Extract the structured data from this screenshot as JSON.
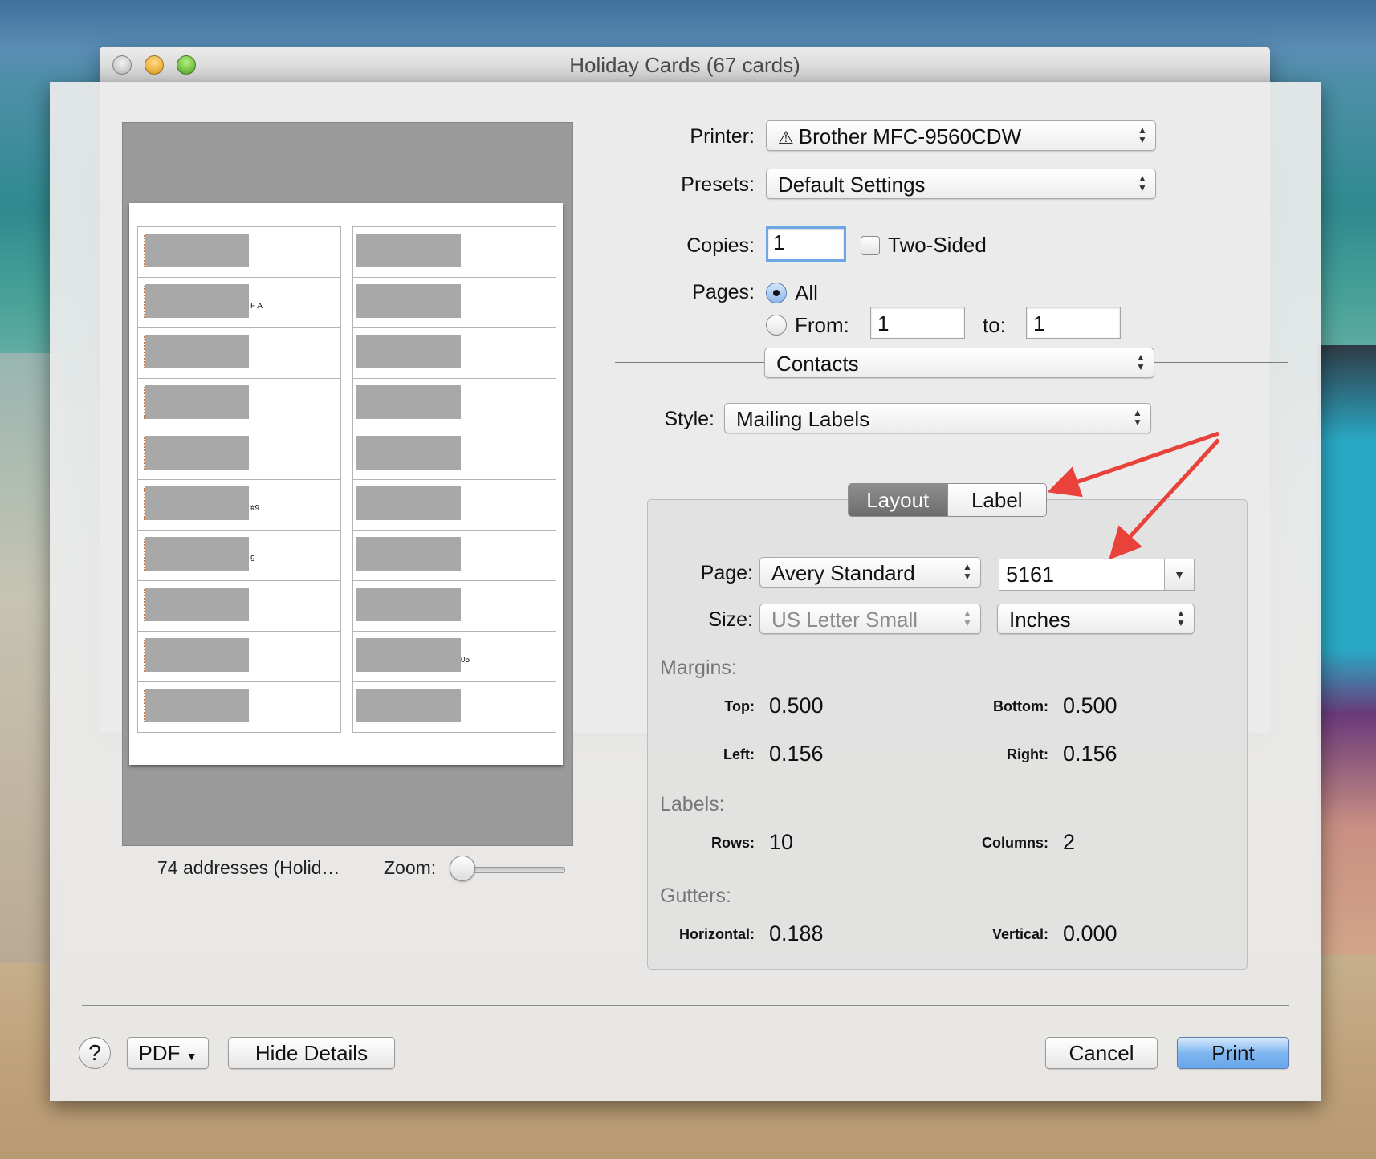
{
  "window": {
    "title": "Holiday Cards (67 cards)"
  },
  "preview": {
    "caption": "74 addresses (Holid…",
    "zoom_label": "Zoom:",
    "zoom_level": 0,
    "labels": [
      {
        "col": 1,
        "tag": ""
      },
      {
        "col": 2,
        "tag": ""
      },
      {
        "col": 1,
        "tag": "F A"
      },
      {
        "col": 2,
        "tag": ""
      },
      {
        "col": 1,
        "tag": ""
      },
      {
        "col": 2,
        "tag": ""
      },
      {
        "col": 1,
        "tag": ""
      },
      {
        "col": 2,
        "tag": ""
      },
      {
        "col": 1,
        "tag": ""
      },
      {
        "col": 2,
        "tag": ""
      },
      {
        "col": 1,
        "tag": "#9"
      },
      {
        "col": 2,
        "tag": ""
      },
      {
        "col": 1,
        "tag": "9"
      },
      {
        "col": 2,
        "tag": ""
      },
      {
        "col": 1,
        "tag": ""
      },
      {
        "col": 2,
        "tag": ""
      },
      {
        "col": 1,
        "tag": ""
      },
      {
        "col": 2,
        "tag": "05"
      },
      {
        "col": 1,
        "tag": ""
      },
      {
        "col": 2,
        "tag": ""
      }
    ]
  },
  "printer": {
    "label": "Printer:",
    "value": "Brother MFC-9560CDW"
  },
  "presets": {
    "label": "Presets:",
    "value": "Default Settings"
  },
  "copies": {
    "label": "Copies:",
    "value": "1",
    "two_sided_label": "Two-Sided",
    "two_sided_checked": false
  },
  "pages": {
    "label": "Pages:",
    "all_label": "All",
    "from_label": "From:",
    "from_value": "1",
    "to_label": "to:",
    "to_value": "1",
    "selected": "All"
  },
  "section_popup": {
    "value": "Contacts"
  },
  "style": {
    "label": "Style:",
    "value": "Mailing Labels"
  },
  "tabs": {
    "layout": "Layout",
    "label": "Label",
    "active": "Layout"
  },
  "page": {
    "label": "Page:",
    "value": "Avery Standard",
    "code": "5161"
  },
  "size": {
    "label": "Size:",
    "value": "US Letter Small",
    "units": "Inches"
  },
  "margins": {
    "title": "Margins:",
    "top_label": "Top:",
    "top": "0.500",
    "bottom_label": "Bottom:",
    "bottom": "0.500",
    "left_label": "Left:",
    "left": "0.156",
    "right_label": "Right:",
    "right": "0.156"
  },
  "labels_section": {
    "title": "Labels:",
    "rows_label": "Rows:",
    "rows": "10",
    "columns_label": "Columns:",
    "columns": "2"
  },
  "gutters": {
    "title": "Gutters:",
    "horizontal_label": "Horizontal:",
    "horizontal": "0.188",
    "vertical_label": "Vertical:",
    "vertical": "0.000"
  },
  "buttons": {
    "help": "?",
    "pdf": "PDF",
    "hide_details": "Hide Details",
    "cancel": "Cancel",
    "print": "Print"
  },
  "colors": {
    "accent": "#6ea6e8",
    "annotation_arrow": "#e8423b",
    "primary_button": "#7fb6ef"
  }
}
